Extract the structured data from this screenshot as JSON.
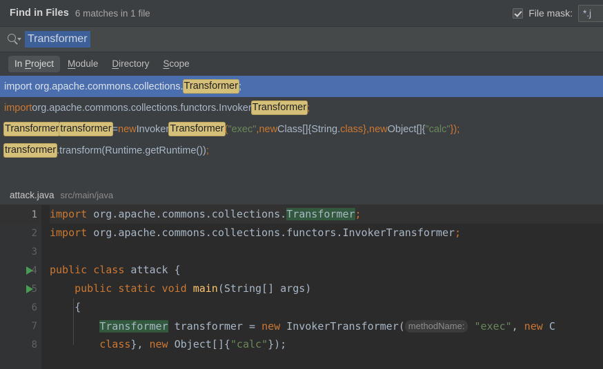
{
  "window": {
    "title": "Find in Files",
    "match_summary": "6 matches in 1 file"
  },
  "file_mask": {
    "checkbox_checked": true,
    "label": "File mask:",
    "value": "*.j",
    "icon": "checkbox-checked-icon"
  },
  "search": {
    "icon": "search-icon",
    "dropdown_icon": "chevron-down-icon",
    "query": "Transformer",
    "selected": true
  },
  "tabs": [
    {
      "id": "in-project",
      "pre": "In ",
      "mnemonic": "P",
      "post": "roject",
      "selected": true
    },
    {
      "id": "module",
      "pre": "",
      "mnemonic": "M",
      "post": "odule",
      "selected": false
    },
    {
      "id": "directory",
      "pre": "",
      "mnemonic": "D",
      "post": "irectory",
      "selected": false
    },
    {
      "id": "scope",
      "pre": "",
      "mnemonic": "S",
      "post": "cope",
      "selected": false
    }
  ],
  "results": [
    {
      "selected": true,
      "segments": [
        {
          "text": "import org.apache.commons.collections.",
          "kind": "plain-s"
        },
        {
          "text": "Transformer",
          "kind": "match"
        },
        {
          "text": ";",
          "kind": "kw-s"
        }
      ]
    },
    {
      "selected": false,
      "segments": [
        {
          "text": "import",
          "kind": "kw"
        },
        {
          "text": " org.apache.commons.collections.functors.Invoker",
          "kind": "plain"
        },
        {
          "text": "Transformer",
          "kind": "match"
        },
        {
          "text": ";",
          "kind": "kw"
        }
      ]
    },
    {
      "selected": false,
      "segments": [
        {
          "text": "Transformer",
          "kind": "match"
        },
        {
          "text": " ",
          "kind": "plain"
        },
        {
          "text": "transformer",
          "kind": "match"
        },
        {
          "text": " = ",
          "kind": "plain"
        },
        {
          "text": "new",
          "kind": "kw"
        },
        {
          "text": " Invoker",
          "kind": "plain"
        },
        {
          "text": "Transformer",
          "kind": "match"
        },
        {
          "text": "(",
          "kind": "kw"
        },
        {
          "text": "\"exec\"",
          "kind": "str"
        },
        {
          "text": ", ",
          "kind": "kw"
        },
        {
          "text": "new",
          "kind": "kw"
        },
        {
          "text": " Class[]{String.",
          "kind": "plain"
        },
        {
          "text": "class",
          "kind": "kw"
        },
        {
          "text": "}, ",
          "kind": "kw"
        },
        {
          "text": "new",
          "kind": "kw"
        },
        {
          "text": " Object[]{",
          "kind": "plain"
        },
        {
          "text": "\"calc\"",
          "kind": "str"
        },
        {
          "text": "});",
          "kind": "kw"
        }
      ]
    },
    {
      "selected": false,
      "segments": [
        {
          "text": "transformer",
          "kind": "match"
        },
        {
          "text": ".transform(Runtime.getRuntime())",
          "kind": "plain"
        },
        {
          "text": ";",
          "kind": "kw"
        }
      ]
    }
  ],
  "file_header": {
    "name": "attack.java",
    "path": "src/main/java"
  },
  "editor": {
    "lines": [
      {
        "number": "1",
        "current": true,
        "run_marker": false,
        "segments": [
          {
            "text": "import",
            "kind": "kw"
          },
          {
            "text": " org.apache.commons.collections.",
            "kind": "pl"
          },
          {
            "text": "Transformer",
            "kind": "hit"
          },
          {
            "text": ";",
            "kind": "kw"
          }
        ]
      },
      {
        "number": "2",
        "current": false,
        "run_marker": false,
        "segments": [
          {
            "text": "import",
            "kind": "kw"
          },
          {
            "text": " org.apache.commons.collections.functors.InvokerTransformer",
            "kind": "pl"
          },
          {
            "text": ";",
            "kind": "kw"
          }
        ]
      },
      {
        "number": "3",
        "current": false,
        "run_marker": false,
        "segments": []
      },
      {
        "number": "4",
        "current": false,
        "run_marker": true,
        "segments": [
          {
            "text": "public class",
            "kind": "kw"
          },
          {
            "text": " attack {",
            "kind": "pl"
          }
        ]
      },
      {
        "number": "5",
        "current": false,
        "run_marker": true,
        "segments": [
          {
            "text": "    ",
            "kind": "pl"
          },
          {
            "text": "public static void",
            "kind": "kw"
          },
          {
            "text": " ",
            "kind": "pl"
          },
          {
            "text": "main",
            "kind": "fn"
          },
          {
            "text": "(String[] args)",
            "kind": "pl"
          }
        ]
      },
      {
        "number": "6",
        "current": false,
        "run_marker": false,
        "segments": [
          {
            "text": "    {",
            "kind": "pl"
          }
        ]
      },
      {
        "number": "7",
        "current": false,
        "run_marker": false,
        "segments": [
          {
            "text": "        ",
            "kind": "pl"
          },
          {
            "text": "Transformer",
            "kind": "hit"
          },
          {
            "text": " transformer = ",
            "kind": "pl"
          },
          {
            "text": "new",
            "kind": "kw"
          },
          {
            "text": " InvokerTransformer(",
            "kind": "pl"
          },
          {
            "text": "methodName:",
            "kind": "hint"
          },
          {
            "text": " ",
            "kind": "pl"
          },
          {
            "text": "\"exec\"",
            "kind": "str"
          },
          {
            "text": ", ",
            "kind": "pl"
          },
          {
            "text": "new",
            "kind": "kw"
          },
          {
            "text": " C",
            "kind": "pl"
          }
        ]
      },
      {
        "number": "8",
        "current": false,
        "run_marker": false,
        "clipped": true,
        "segments": [
          {
            "text": "        ",
            "kind": "pl"
          },
          {
            "text": "class",
            "kind": "kw"
          },
          {
            "text": "}, ",
            "kind": "pl"
          },
          {
            "text": "new",
            "kind": "kw"
          },
          {
            "text": " Object[]{",
            "kind": "pl"
          },
          {
            "text": "\"calc\"",
            "kind": "str"
          },
          {
            "text": "});",
            "kind": "pl"
          }
        ]
      }
    ]
  },
  "colors": {
    "window_bg": "#3c3f41",
    "search_bg": "#45494a",
    "selection_blue": "#4b6eaf",
    "match_highlight": "#d5c07a",
    "editor_bg": "#2b2b2b",
    "gutter_bg": "#313335",
    "keyword_orange": "#cc7832",
    "string_green": "#6a8759",
    "run_green": "#499c54",
    "editor_hit": "#32593d"
  }
}
